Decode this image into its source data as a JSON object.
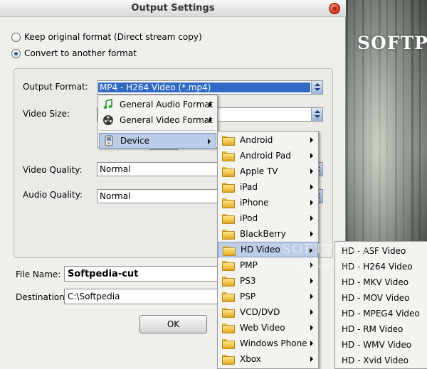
{
  "window": {
    "title": "Output Settings"
  },
  "radio": {
    "keep_label": "Keep original format (Direct stream copy)",
    "convert_label": "Convert to another format"
  },
  "form": {
    "output_format_label": "Output Format:",
    "output_format_value": "MP4 - H264 Video (*.mp4)",
    "video_size_label": "Video Size:",
    "video_quality_label": "Video Quality:",
    "video_quality_value": "Normal",
    "audio_quality_label": "Audio Quality:",
    "audio_quality_value": "Normal",
    "file_name_label": "File Name:",
    "file_name_value": "Softpedia-cut",
    "destination_label": "Destination:",
    "destination_value": "C:\\Softpedia",
    "ok_label": "OK"
  },
  "format_menu": {
    "items": [
      {
        "label": "General Audio Format",
        "icon": "music-note-icon"
      },
      {
        "label": "General Video Format",
        "icon": "film-reel-icon"
      },
      {
        "label": "Device",
        "icon": "device-icon"
      }
    ]
  },
  "device_menu": {
    "items": [
      "Android",
      "Android Pad",
      "Apple TV",
      "iPad",
      "iPhone",
      "iPod",
      "BlackBerry",
      "HD Video",
      "PMP",
      "PS3",
      "PSP",
      "VCD/DVD",
      "Web Video",
      "Windows Phone",
      "Xbox"
    ],
    "highlighted": "HD Video"
  },
  "hd_menu": {
    "items": [
      "HD - ASF Video",
      "HD - H264 Video",
      "HD - MKV Video",
      "HD - MOV Video",
      "HD - MPEG4 Video",
      "HD - RM Video",
      "HD - WMV Video",
      "HD - Xvid Video"
    ]
  },
  "background": {
    "brand": "SOFTP",
    "watermark": "SOFTPEDIA",
    "watermark_url": "www.softpedia.com"
  },
  "colors": {
    "selection": "#316ac5",
    "menu_highlight": "#bccde8",
    "folder": "#f0c247"
  }
}
